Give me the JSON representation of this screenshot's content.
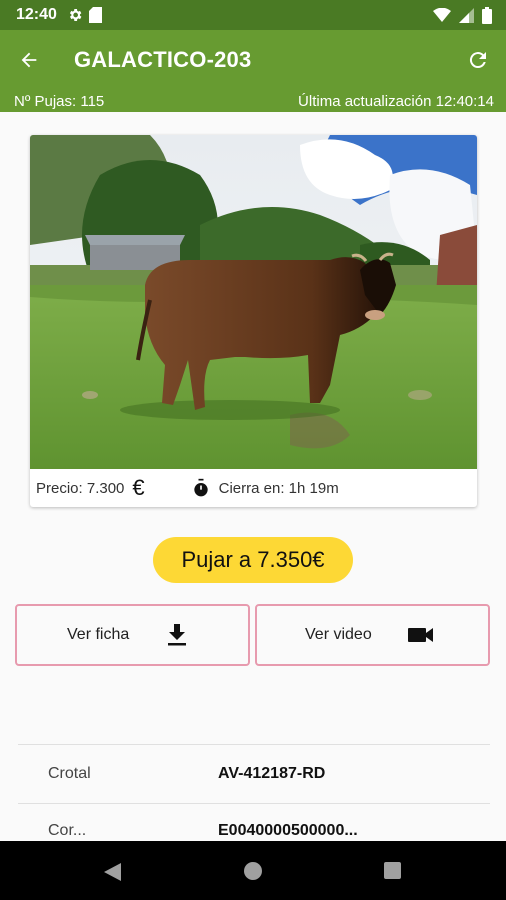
{
  "status_bar": {
    "time": "12:40"
  },
  "app_bar": {
    "title": "GALACTICO-203"
  },
  "sub_bar": {
    "bids": "Nº Pujas: 115",
    "last_update": "Última actualización 12:40:14"
  },
  "card": {
    "price": "Precio: 7.300",
    "closes": "Cierra en: 1h 19m"
  },
  "actions": {
    "bid_label": "Pujar a 7.350€",
    "ficha_label": "Ver ficha",
    "video_label": "Ver video"
  },
  "details": {
    "rows": [
      {
        "key": "Crotal",
        "value": "AV-412187-RD"
      },
      {
        "key": "Cor...",
        "value": "E0040000500000..."
      }
    ]
  },
  "colors": {
    "status_bar": "#4a7a24",
    "app_bar": "#679b31",
    "bid_button": "#fdd835",
    "outline": "#e79aae"
  },
  "icons": {
    "back": "arrow-left-icon",
    "refresh": "refresh-icon",
    "euro": "euro-icon",
    "timer": "stopwatch-icon",
    "download": "download-icon",
    "video": "videocam-icon"
  }
}
